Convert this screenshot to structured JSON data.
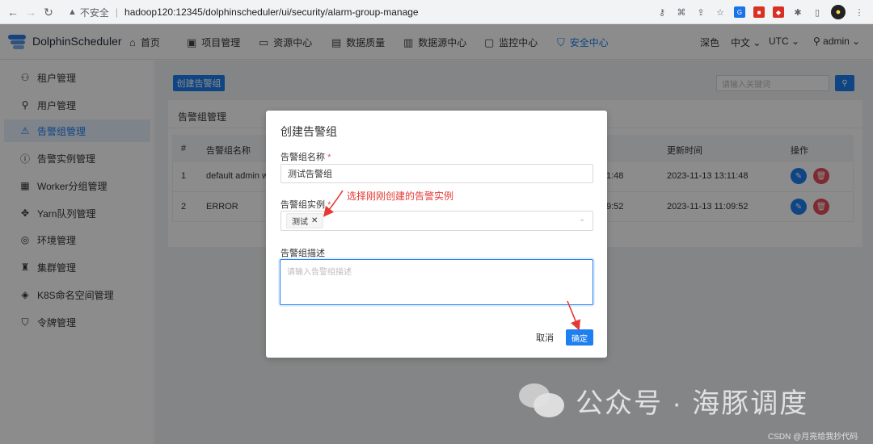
{
  "browser": {
    "insecure_label": "不安全",
    "url": "hadoop120:12345/dolphinscheduler/ui/security/alarm-group-manage"
  },
  "app": {
    "name": "DolphinScheduler",
    "menu": [
      {
        "label": "首页",
        "icon": "home-icon",
        "glyph": "⌂"
      },
      {
        "label": "项目管理",
        "icon": "project-icon",
        "glyph": "▣"
      },
      {
        "label": "资源中心",
        "icon": "folder-icon",
        "glyph": "▭"
      },
      {
        "label": "数据质量",
        "icon": "quality-icon",
        "glyph": "▤"
      },
      {
        "label": "数据源中心",
        "icon": "datasource-icon",
        "glyph": "▥"
      },
      {
        "label": "监控中心",
        "icon": "monitor-icon",
        "glyph": "▢"
      },
      {
        "label": "安全中心",
        "icon": "shield-icon",
        "glyph": "⛉"
      }
    ],
    "active_menu": "安全中心",
    "right": {
      "theme": "深色",
      "language": "中文",
      "timezone": "UTC",
      "user": "admin"
    }
  },
  "sidebar": {
    "items": [
      {
        "label": "租户管理",
        "icon": "tenant-icon",
        "glyph": "⚇"
      },
      {
        "label": "用户管理",
        "icon": "user-icon",
        "glyph": "⚲"
      },
      {
        "label": "告警组管理",
        "icon": "warning-icon",
        "glyph": "⚠"
      },
      {
        "label": "告警实例管理",
        "icon": "info-icon",
        "glyph": "ⓘ"
      },
      {
        "label": "Worker分组管理",
        "icon": "worker-icon",
        "glyph": "▦"
      },
      {
        "label": "Yarn队列管理",
        "icon": "yarn-icon",
        "glyph": "✥"
      },
      {
        "label": "环境管理",
        "icon": "environment-icon",
        "glyph": "◎"
      },
      {
        "label": "集群管理",
        "icon": "cluster-icon",
        "glyph": "♜"
      },
      {
        "label": "K8S命名空间管理",
        "icon": "namespace-icon",
        "glyph": "◈"
      },
      {
        "label": "令牌管理",
        "icon": "token-icon",
        "glyph": "⛉"
      }
    ],
    "active": "告警组管理"
  },
  "toolbar": {
    "create_label": "创建告警组",
    "search_placeholder": "请输入关键词",
    "search_icon": "search-icon"
  },
  "card": {
    "title": "告警组管理"
  },
  "table": {
    "headers": [
      "#",
      "告警组名称",
      "更新时间",
      "操作"
    ],
    "rows": [
      {
        "index": "1",
        "name": "default admin w",
        "create_fragment": "1:48",
        "updated": "2023-11-13 13:11:48"
      },
      {
        "index": "2",
        "name": "ERROR",
        "create_fragment": "9:52",
        "updated": "2023-11-13 11:09:52"
      }
    ]
  },
  "modal": {
    "title": "创建告警组",
    "name_label": "告警组名称",
    "name_value": "测试告警组",
    "instance_label": "告警组实例",
    "instance_tag": "测试",
    "desc_label": "告警组描述",
    "desc_placeholder": "请输入告警组描述",
    "cancel_label": "取消",
    "confirm_label": "确定",
    "required_mark": "*"
  },
  "annotation": {
    "text": "选择刚刚创建的告警实例",
    "color": "#e53935"
  },
  "watermark": {
    "text": "公众号 · 海豚调度",
    "credit": "CSDN @月亮给我抄代码"
  },
  "colors": {
    "primary": "#1e7ff0",
    "danger": "#e34d59"
  }
}
